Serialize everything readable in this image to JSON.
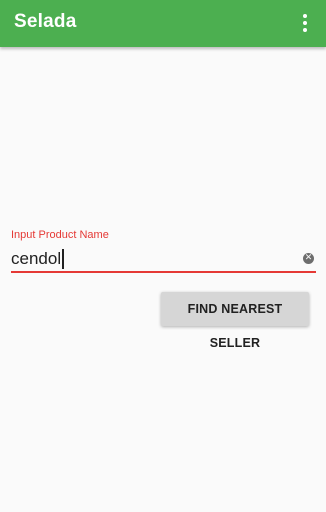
{
  "appbar": {
    "title": "Selada",
    "menu_icon": "more-vert-icon",
    "color": "#4caf50"
  },
  "form": {
    "input_label": "Input Product Name",
    "input_value": "cendol",
    "clear_icon": "clear-icon",
    "accent_color": "#e53935"
  },
  "actions": {
    "find_label": "FIND NEAREST SELLER"
  }
}
